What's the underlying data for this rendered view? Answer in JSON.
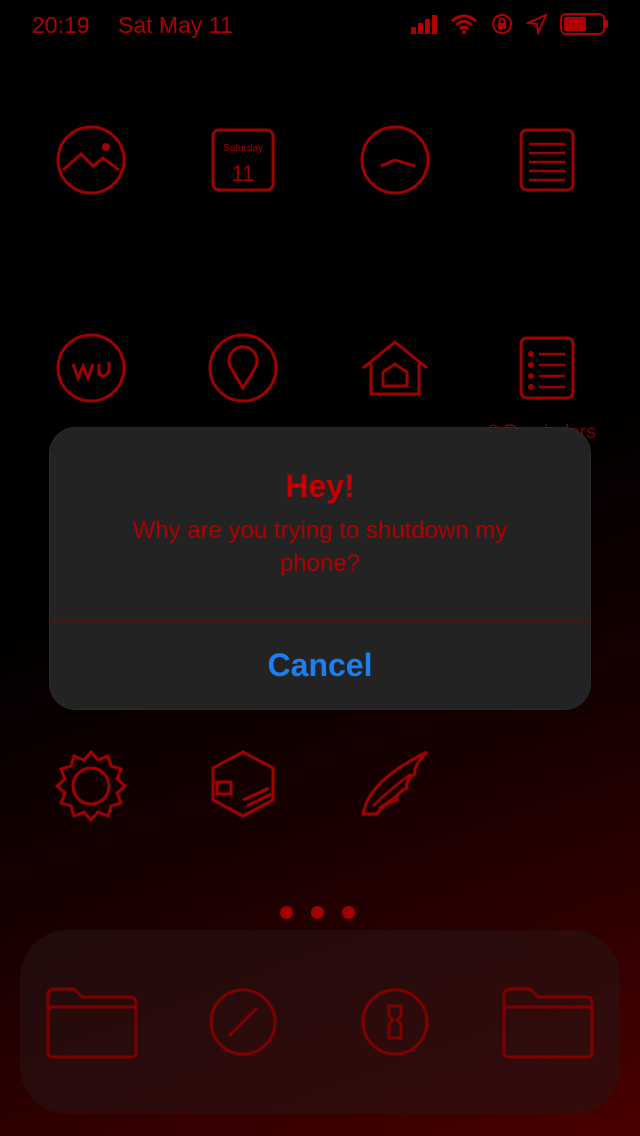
{
  "status_bar": {
    "time": "20:19",
    "date": "Sat May 11"
  },
  "home_icons": [
    {
      "name": "photos-icon"
    },
    {
      "name": "calendar-icon",
      "weekday": "Saturday",
      "day": "11"
    },
    {
      "name": "clock-icon"
    },
    {
      "name": "notes-icon"
    },
    {
      "name": "weather-underground-icon"
    },
    {
      "name": "maps-icon"
    },
    {
      "name": "home-icon"
    },
    {
      "name": "reminders-icon"
    },
    {
      "name": "settings-icon"
    },
    {
      "name": "cydia-box-icon"
    },
    {
      "name": "wing-icon"
    }
  ],
  "reminders_label": "3 Reminders",
  "page_dots": 3,
  "dock_icons": [
    {
      "name": "folder-icon"
    },
    {
      "name": "safari-icon"
    },
    {
      "name": "1password-icon"
    },
    {
      "name": "folder-icon"
    }
  ],
  "alert": {
    "title": "Hey!",
    "message": "Why are you trying to shutdown my phone?",
    "cancel_label": "Cancel"
  },
  "colors": {
    "accent_red": "#b00000",
    "alert_bg": "#232323",
    "button_blue": "#1a7ff0"
  }
}
